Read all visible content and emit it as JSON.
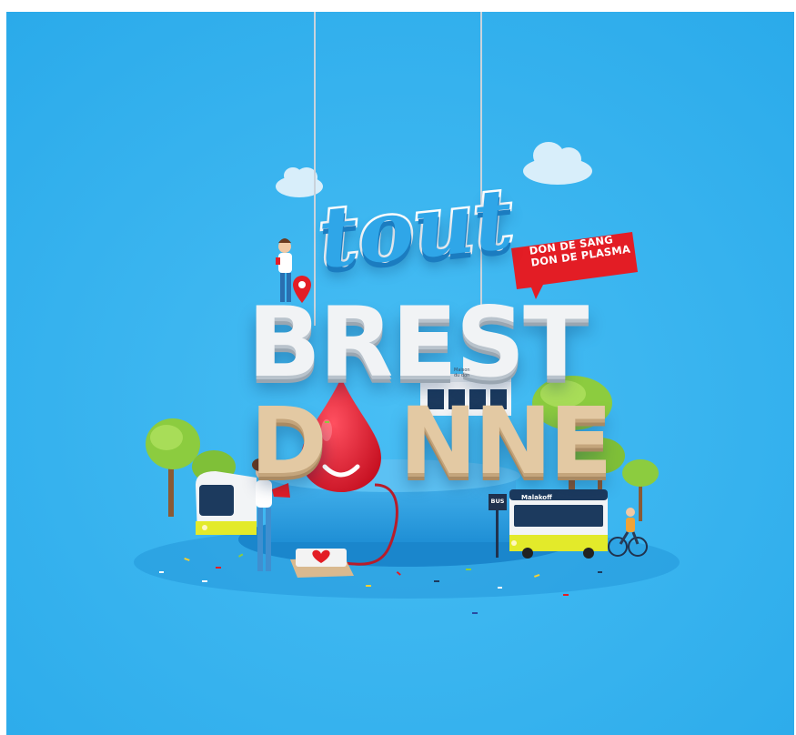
{
  "poster": {
    "badge_line_1": "DON DE SANG",
    "badge_line_2": "DON DE PLASMA",
    "word_tout": "tout",
    "word_brest": "BREST",
    "word_donne_first": "D",
    "word_donne_rest": "NNE",
    "bus_sign": "BUS",
    "bus_destination": "Malakoff",
    "building_sign_line_1": "Maison",
    "building_sign_line_2": "du don"
  },
  "colors": {
    "sky": "#33b2ef",
    "badge_red": "#e31d25",
    "drop_red": "#e01b2b",
    "tree_green": "#8ccc3f",
    "tram_yellow": "#e3ea2a",
    "platform_blue": "#2a9fe3"
  }
}
